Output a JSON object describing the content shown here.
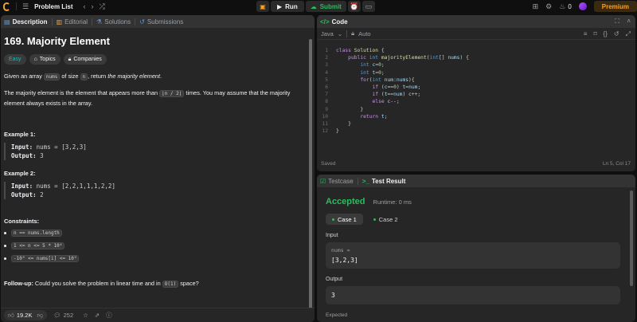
{
  "topbar": {
    "problem_list_label": "Problem List",
    "run_label": "Run",
    "submit_label": "Submit",
    "streak_count": "0",
    "premium_label": "Premium"
  },
  "left_tabs": [
    {
      "label": "Description",
      "icon": "document-icon"
    },
    {
      "label": "Editorial",
      "icon": "book-icon"
    },
    {
      "label": "Solutions",
      "icon": "flask-icon"
    },
    {
      "label": "Submissions",
      "icon": "history-icon"
    }
  ],
  "problem": {
    "title": "169. Majority Element",
    "difficulty": "Easy",
    "topics_label": "Topics",
    "companies_label": "Companies",
    "para1_pre": "Given an array ",
    "para1_code1": "nums",
    "para1_mid": " of size ",
    "para1_code2": "n",
    "para1_post": ", return ",
    "para1_em": "the majority element",
    "para1_end": ".",
    "para2_pre": "The majority element is the element that appears more than ",
    "para2_code": "⌊n / 2⌋",
    "para2_post": " times. You may assume that the majority element always exists in the array.",
    "examples": [
      {
        "title": "Example 1:",
        "input_label": "Input:",
        "input": "nums = [3,2,3]",
        "output_label": "Output:",
        "output": "3"
      },
      {
        "title": "Example 2:",
        "input_label": "Input:",
        "input": "nums = [2,2,1,1,1,2,2]",
        "output_label": "Output:",
        "output": "2"
      }
    ],
    "constraints_title": "Constraints:",
    "constraints": [
      "n == nums.length",
      "1 <= n <= 5 * 10⁴",
      "-10⁹ <= nums[i] <= 10⁹"
    ],
    "followup_bold": "Follow-up:",
    "followup_text": " Could you solve the problem in linear time and in ",
    "followup_code": "O(1)",
    "followup_end": " space?"
  },
  "desc_footer": {
    "likes": "19.2K",
    "comments": "252"
  },
  "code_panel": {
    "title": "Code",
    "language": "Java",
    "mode": "Auto",
    "status": "Saved",
    "cursor": "Ln 5, Col 17"
  },
  "result_panel": {
    "testcase_tab": "Testcase",
    "result_tab": "Test Result",
    "verdict": "Accepted",
    "runtime": "Runtime: 0 ms",
    "cases": [
      "Case 1",
      "Case 2"
    ],
    "input_label": "Input",
    "input_var": "nums =",
    "input_value": "[3,2,3]",
    "output_label": "Output",
    "output_value": "3",
    "expected_label": "Expected"
  },
  "colors": {
    "accepted": "#2cbb5d",
    "easy": "#1cbaba",
    "premium": "#ffa116"
  }
}
